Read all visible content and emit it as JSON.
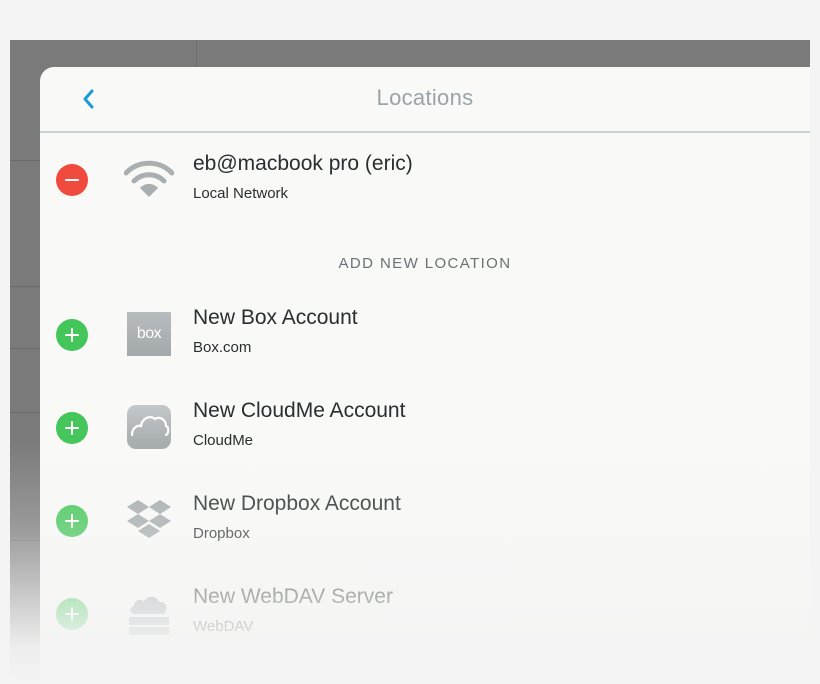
{
  "navbar": {
    "title": "Locations",
    "back_icon": "chevron-left-icon"
  },
  "colors": {
    "accent": "#1a9bd7",
    "remove": "#f04a3e",
    "add": "#45c65a",
    "title_text": "#9aa4a8"
  },
  "current_location": {
    "name": "eb@macbook pro (eric)",
    "type": "Local Network",
    "icon": "wifi-icon",
    "action_icon": "minus-icon"
  },
  "add_section": {
    "header": "ADD NEW LOCATION",
    "items": [
      {
        "name": "New Box Account",
        "provider": "Box.com",
        "icon": "box-logo-icon",
        "icon_text": "box",
        "action_icon": "plus-icon"
      },
      {
        "name": "New CloudMe Account",
        "provider": "CloudMe",
        "icon": "cloudme-icon",
        "action_icon": "plus-icon"
      },
      {
        "name": "New Dropbox Account",
        "provider": "Dropbox",
        "icon": "dropbox-icon",
        "action_icon": "plus-icon"
      },
      {
        "name": "New WebDAV Server",
        "provider": "WebDAV",
        "icon": "webdav-cloud-server-icon",
        "action_icon": "plus-icon"
      }
    ]
  }
}
